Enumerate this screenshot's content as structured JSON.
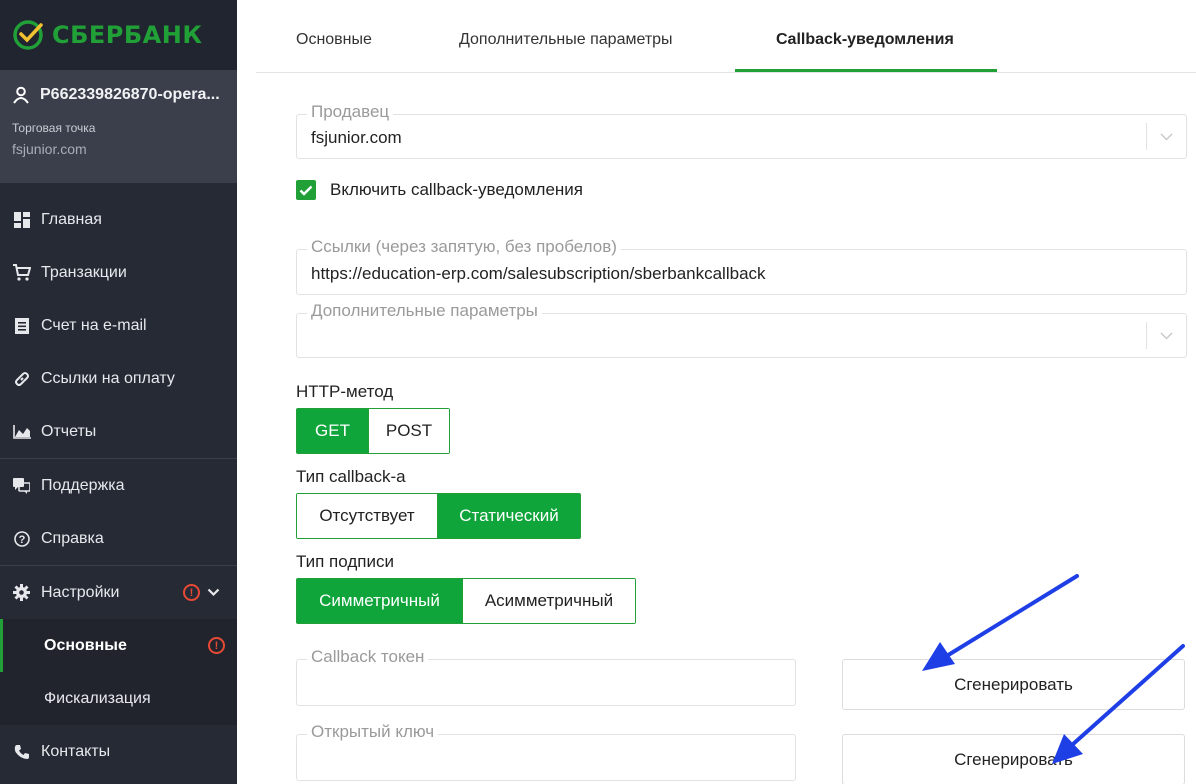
{
  "brand": {
    "name": "СБЕРБАНК",
    "color": "#21a038",
    "icon": "sberbank-logo-icon"
  },
  "account": {
    "name": "P662339826870-opera...",
    "icon": "user-icon",
    "shop_label": "Торговая точка",
    "shop_value": "fsjunior.com"
  },
  "nav": {
    "main": "Главная",
    "transactions": "Транзакции",
    "invoice": "Счет на e-mail",
    "pay_links": "Ссылки на оплату",
    "reports": "Отчеты",
    "support": "Поддержка",
    "help": "Справка",
    "settings": "Настройки",
    "settings_basic": "Основные",
    "settings_fiscal": "Фискализация",
    "contacts": "Контакты"
  },
  "tabs": [
    {
      "label": "Основные"
    },
    {
      "label": "Дополнительные параметры"
    },
    {
      "label": "Callback-уведомления",
      "active": true
    }
  ],
  "form": {
    "seller_label": "Продавец",
    "seller_value": "fsjunior.com",
    "enable_callback_label": "Включить callback-уведомления",
    "enable_callback_checked": true,
    "links_label": "Ссылки (через запятую, без пробелов)",
    "links_value": "https://education-erp.com/salesubscription/sberbankcallback",
    "extra_params_label": "Дополнительные параметры",
    "extra_params_value": "",
    "http_method_label": "HTTP-метод",
    "http_methods": [
      "GET",
      "POST"
    ],
    "http_method_selected": "GET",
    "callback_type_label": "Тип callback-а",
    "callback_types": [
      "Отсутствует",
      "Статический"
    ],
    "callback_type_selected": "Статический",
    "signature_type_label": "Тип подписи",
    "signature_types": [
      "Симметричный",
      "Асимметричный"
    ],
    "signature_type_selected": "Симметричный",
    "callback_token_label": "Callback токен",
    "callback_token_value": "",
    "public_key_label": "Открытый ключ",
    "public_key_value": "",
    "generate_label": "Сгенерировать"
  },
  "colors": {
    "accent": "#21a038",
    "sidebar": "#262a35",
    "warning": "#e64a35",
    "annotation_arrow": "#1f3fe6"
  }
}
